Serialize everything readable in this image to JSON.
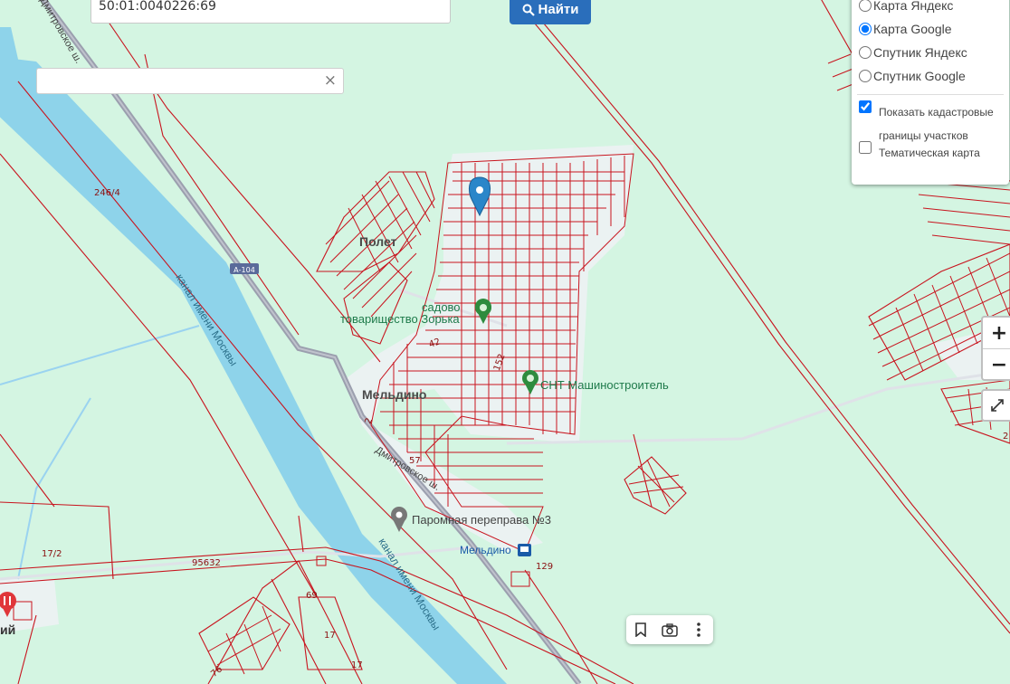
{
  "search": {
    "value": "50:01:0040226:69",
    "button_label": "Найти"
  },
  "address": {
    "value": "",
    "clear": "×"
  },
  "layers": {
    "options": [
      "Карта Яндекс",
      "Карта Google",
      "Спутник Яндекс",
      "Спутник Google"
    ],
    "selected": "Карта Google",
    "show_cadastral_label": "Показать кадастровые границы участков",
    "show_cadastral": true,
    "thematic_label": "Тематическая карта",
    "thematic": false
  },
  "zoom": {
    "in": "+",
    "out": "−"
  },
  "map_labels": {
    "polet": "Полет",
    "sad_1": "садово",
    "sad_2": "товарищество Зорька",
    "snt": "СНТ Машиностроитель",
    "meldino": "Мельдино",
    "canal_1": "канал имени Москвы",
    "canal_2": "канал имени Москвы",
    "dmitrov": "Дмитровское ш.",
    "ferry": "Паромная переправа №3",
    "station": "Мельдино",
    "a104": "А-104",
    "road_top": "Дмитровское ш.",
    "edge_left": "ий"
  },
  "parcel_numbers": {
    "n246": "246/4",
    "n17_2": "17/2",
    "n95632": "95632",
    "n129": "129",
    "n69": "69",
    "n17a": "17",
    "n17b": "17",
    "n76": "76",
    "n152": "152",
    "n42": "42",
    "n57": "57",
    "n2": "2",
    "n2r": "2"
  },
  "colors": {
    "land": "#d4f5e2",
    "water": "#8ed3ea",
    "parcel": "#c8141e",
    "road": "#9b9fae",
    "accent": "#2a6ebb"
  }
}
